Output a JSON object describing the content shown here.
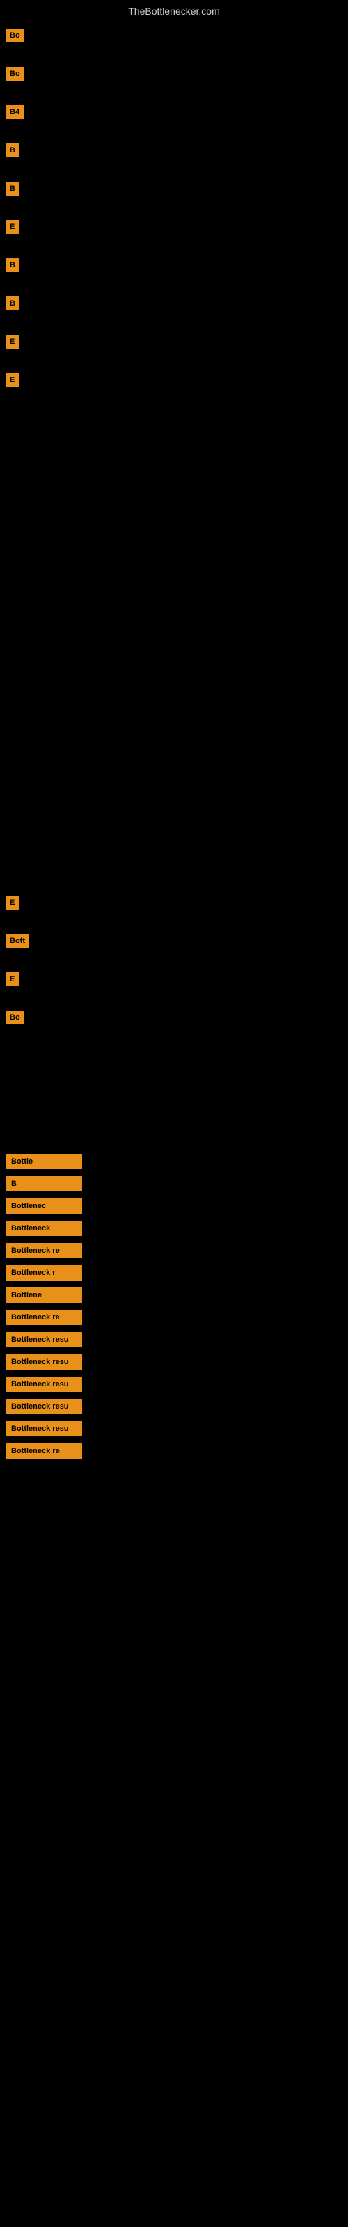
{
  "site": {
    "title": "TheBottlenecker.com"
  },
  "top_buttons": [
    {
      "id": "btn1",
      "label": "Bo"
    },
    {
      "id": "btn2",
      "label": "Bo"
    },
    {
      "id": "btn3",
      "label": "B4"
    },
    {
      "id": "btn4",
      "label": "B"
    },
    {
      "id": "btn5",
      "label": "B"
    },
    {
      "id": "btn6",
      "label": "E"
    },
    {
      "id": "btn7",
      "label": "B"
    },
    {
      "id": "btn8",
      "label": "B"
    },
    {
      "id": "btn9",
      "label": "E"
    },
    {
      "id": "btn10",
      "label": "E"
    }
  ],
  "mid_buttons": [
    {
      "id": "mbtn1",
      "label": "E"
    },
    {
      "id": "mbtn2",
      "label": "Bott"
    },
    {
      "id": "mbtn3",
      "label": "E"
    },
    {
      "id": "mbtn4",
      "label": "Bo"
    }
  ],
  "lower_buttons": [
    {
      "id": "lbtn1",
      "label": "Bottle"
    },
    {
      "id": "lbtn2",
      "label": "B"
    },
    {
      "id": "lbtn3",
      "label": "Bottlenec"
    },
    {
      "id": "lbtn4",
      "label": "Bottleneck"
    },
    {
      "id": "lbtn5",
      "label": "Bottleneck re"
    },
    {
      "id": "lbtn6",
      "label": "Bottleneck r"
    },
    {
      "id": "lbtn7",
      "label": "Bottlene"
    },
    {
      "id": "lbtn8",
      "label": "Bottleneck re"
    },
    {
      "id": "lbtn9",
      "label": "Bottleneck resu"
    },
    {
      "id": "lbtn10",
      "label": "Bottleneck resu"
    },
    {
      "id": "lbtn11",
      "label": "Bottleneck resu"
    },
    {
      "id": "lbtn12",
      "label": "Bottleneck resu"
    },
    {
      "id": "lbtn13",
      "label": "Bottleneck resu"
    },
    {
      "id": "lbtn14",
      "label": "Bottleneck re"
    }
  ]
}
